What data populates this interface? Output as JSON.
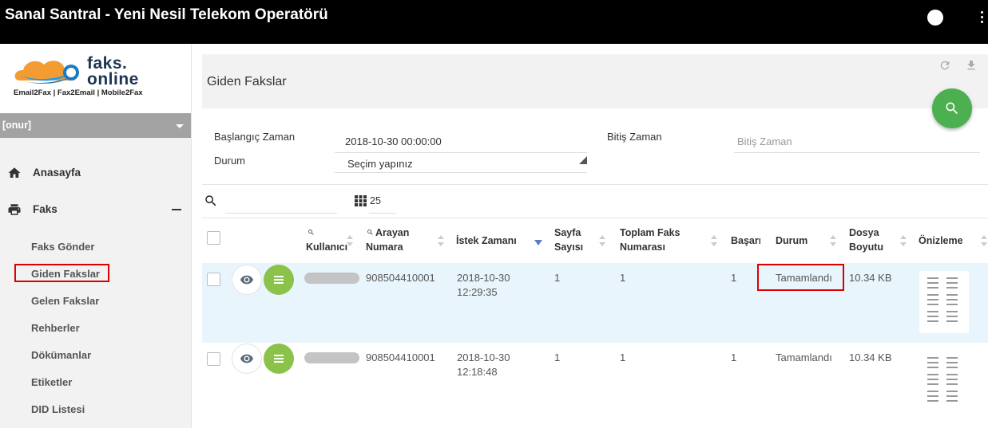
{
  "app": {
    "title": "Sanal Santral - Yeni Nesil Telekom Operatörü"
  },
  "brand": {
    "line1": "faks.",
    "line2": "online",
    "tagline": "Email2Fax | Fax2Email | Mobile2Fax",
    "color": "#1d3552"
  },
  "user": {
    "name": "[onur]"
  },
  "nav": {
    "home": "Anasayfa",
    "fax": "Faks",
    "fax_sub": [
      "Faks Gönder",
      "Giden Fakslar",
      "Gelen Fakslar",
      "Rehberler",
      "Dökümanlar",
      "Etiketler",
      "DID Listesi"
    ]
  },
  "page": {
    "title": "Giden Fakslar"
  },
  "filters": {
    "start_label": "Başlangıç Zaman",
    "start_value": "2018-10-30 00:00:00",
    "end_label": "Bitiş Zaman",
    "end_placeholder": "Bitiş Zaman",
    "status_label": "Durum",
    "status_value": "Seçim yapınız"
  },
  "toolbar": {
    "page_size": "25"
  },
  "table": {
    "headers": {
      "user": "Kullanıcı",
      "caller_1": "Arayan",
      "caller_2": "Numara",
      "request_time": "İstek Zamanı",
      "pages_1": "Sayfa",
      "pages_2": "Sayısı",
      "total_1": "Toplam Faks",
      "total_2": "Numarası",
      "success": "Başarı",
      "status": "Durum",
      "size_1": "Dosya",
      "size_2": "Boyutu",
      "preview": "Önizleme"
    },
    "rows": [
      {
        "caller": "908504410001",
        "date": "2018-10-30",
        "time": "12:29:35",
        "pages": "1",
        "total": "1",
        "success": "1",
        "status": "Tamamlandı",
        "size": "10.34 KB"
      },
      {
        "caller": "908504410001",
        "date": "2018-10-30",
        "time": "12:18:48",
        "pages": "1",
        "total": "1",
        "success": "1",
        "status": "Tamamlandı",
        "size": "10.34 KB"
      }
    ]
  },
  "colors": {
    "accent_green": "#4caf50",
    "menu_green": "#8bc34a",
    "highlight_red": "#dd0000",
    "row_highlight": "#e8f5fc"
  }
}
